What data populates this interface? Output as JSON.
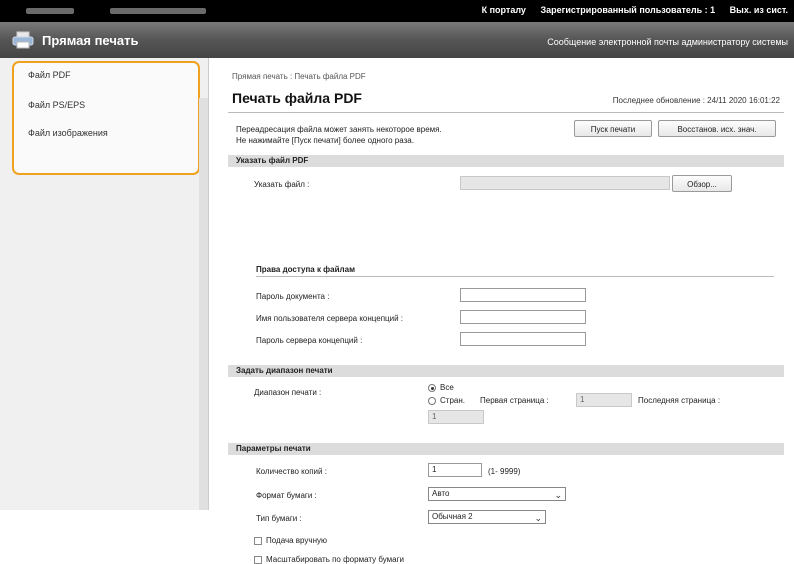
{
  "topbar": {
    "portal_link": "К порталу",
    "registered_user_label": "Зарегистрированный пользователь : 1",
    "logout_link": "Вых. из сист."
  },
  "titlebar": {
    "title": "Прямая печать",
    "mail_link": "Сообщение электронной почты администратору системы"
  },
  "sidebar": {
    "items": [
      {
        "label": "Файл PDF"
      },
      {
        "label": "Файл PS/EPS"
      },
      {
        "label": "Файл изображения"
      }
    ],
    "highlight_color": "#f0a21f"
  },
  "main": {
    "breadcrumb": "Прямая печать : Печать файла PDF",
    "page_title": "Печать файла PDF",
    "last_updated": "Последнее обновление : 24/11 2020 16:01:22",
    "notice_line1": "Переадресация файла может занять некоторое время.",
    "notice_line2": "Не нажимайте [Пуск печати] более одного раза.",
    "start_print_button": "Пуск печати",
    "restore_button": "Восстанов. исх. знач.",
    "section_file": {
      "title": "Указать файл PDF",
      "file_label": "Указать файл :",
      "browse_button": "Обзор...",
      "access_rights_heading": "Права доступа к файлам",
      "doc_password_label": "Пароль документа :",
      "policy_user_label": "Имя пользователя сервера концепций :",
      "policy_password_label": "Пароль сервера концепций :"
    },
    "section_range": {
      "title": "Задать диапазон печати",
      "range_label": "Диапазон печати :",
      "option_all": "Все",
      "option_pages": "Стран.",
      "first_page_label": "Первая страница :",
      "first_page_value": "1",
      "last_page_label": "Последняя страница :",
      "last_page_value": "1"
    },
    "section_params": {
      "title": "Параметры печати",
      "copies_label": "Количество копий :",
      "copies_value": "1",
      "copies_range": "(1- 9999)",
      "paper_size_label": "Формат бумаги :",
      "paper_size_value": "Авто",
      "paper_type_label": "Тип бумаги :",
      "paper_type_value": "Обычная 2",
      "manual_feed_label": "Подача вручную",
      "scale_label": "Масштабировать по формату бумаги"
    }
  }
}
